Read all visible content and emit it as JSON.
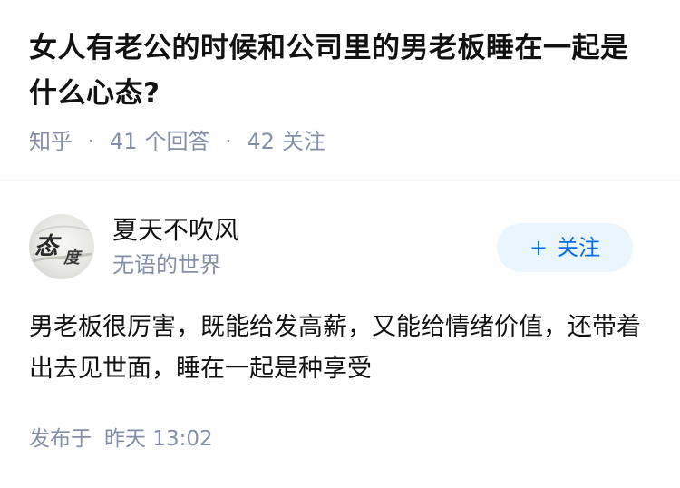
{
  "question": {
    "title": "女人有老公的时候和公司里的男老板睡在一起是什么心态?",
    "source": "知乎",
    "answers_count": "41",
    "answers_label": "个回答",
    "followers_count": "42",
    "followers_label": "关注"
  },
  "author": {
    "name": "夏天不吹风",
    "bio": "无语的世界",
    "avatar_text": "态度",
    "follow_label": "关注",
    "follow_icon": "plus-icon"
  },
  "answer": {
    "content": "男老板很厉害，既能给发高薪，又能给情绪价值，还带着出去见世面，睡在一起是种享受",
    "time_label": "发布于",
    "time_value": "昨天 13:02"
  },
  "colors": {
    "text_primary": "#121212",
    "text_secondary": "#8590a6",
    "accent": "#056de8",
    "follow_bg": "#ebf5fd",
    "divider": "#f3f4f6"
  }
}
